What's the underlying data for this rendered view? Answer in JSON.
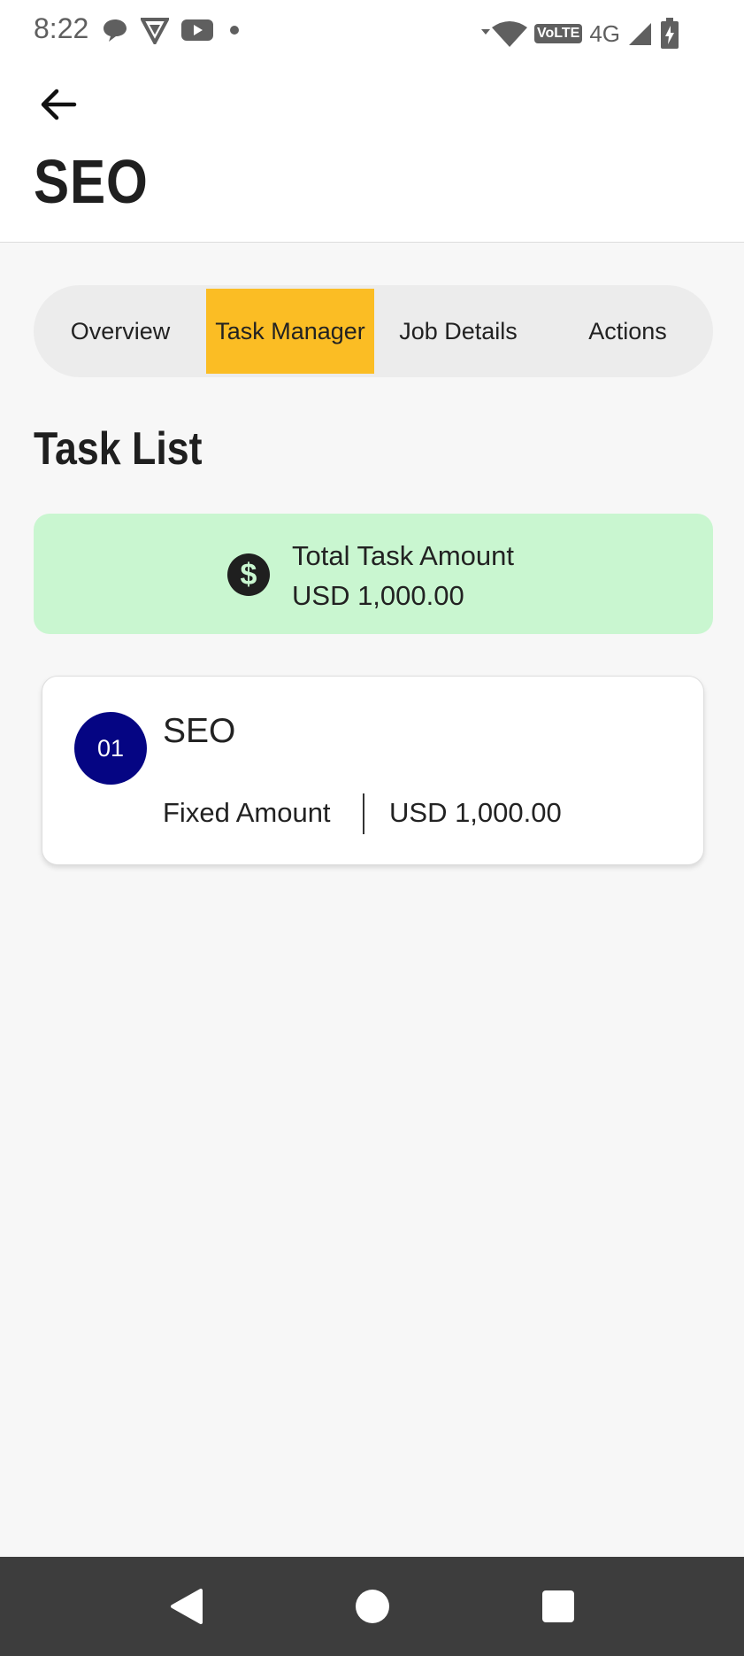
{
  "status_bar": {
    "time": "8:22",
    "network_label": "4G",
    "volte_label": "VoLTE",
    "icons": [
      "chat-bubble-icon",
      "vpn-shield-icon",
      "youtube-icon",
      "dot-icon",
      "wifi-icon",
      "signal-icon",
      "battery-icon"
    ]
  },
  "header": {
    "back_icon": "back-arrow-icon",
    "title": "SEO"
  },
  "tabs": [
    {
      "label": "Overview",
      "active": false
    },
    {
      "label": "Task Manager",
      "active": true
    },
    {
      "label": "Job Details",
      "active": false
    },
    {
      "label": "Actions",
      "active": false
    }
  ],
  "task_list": {
    "title": "Task List",
    "total": {
      "icon": "dollar-circle-icon",
      "label": "Total Task Amount",
      "value": "USD 1,000.00"
    },
    "tasks": [
      {
        "number": "01",
        "name": "SEO",
        "type": "Fixed Amount",
        "amount": "USD 1,000.00"
      }
    ]
  },
  "nav_bar": {
    "icons": [
      "back-triangle-icon",
      "home-circle-icon",
      "recents-square-icon"
    ]
  },
  "colors": {
    "accent_tab": "#fbbd24",
    "total_card": "#c9f6d0",
    "task_badge": "#050583",
    "navbar": "#3d3d3d"
  }
}
